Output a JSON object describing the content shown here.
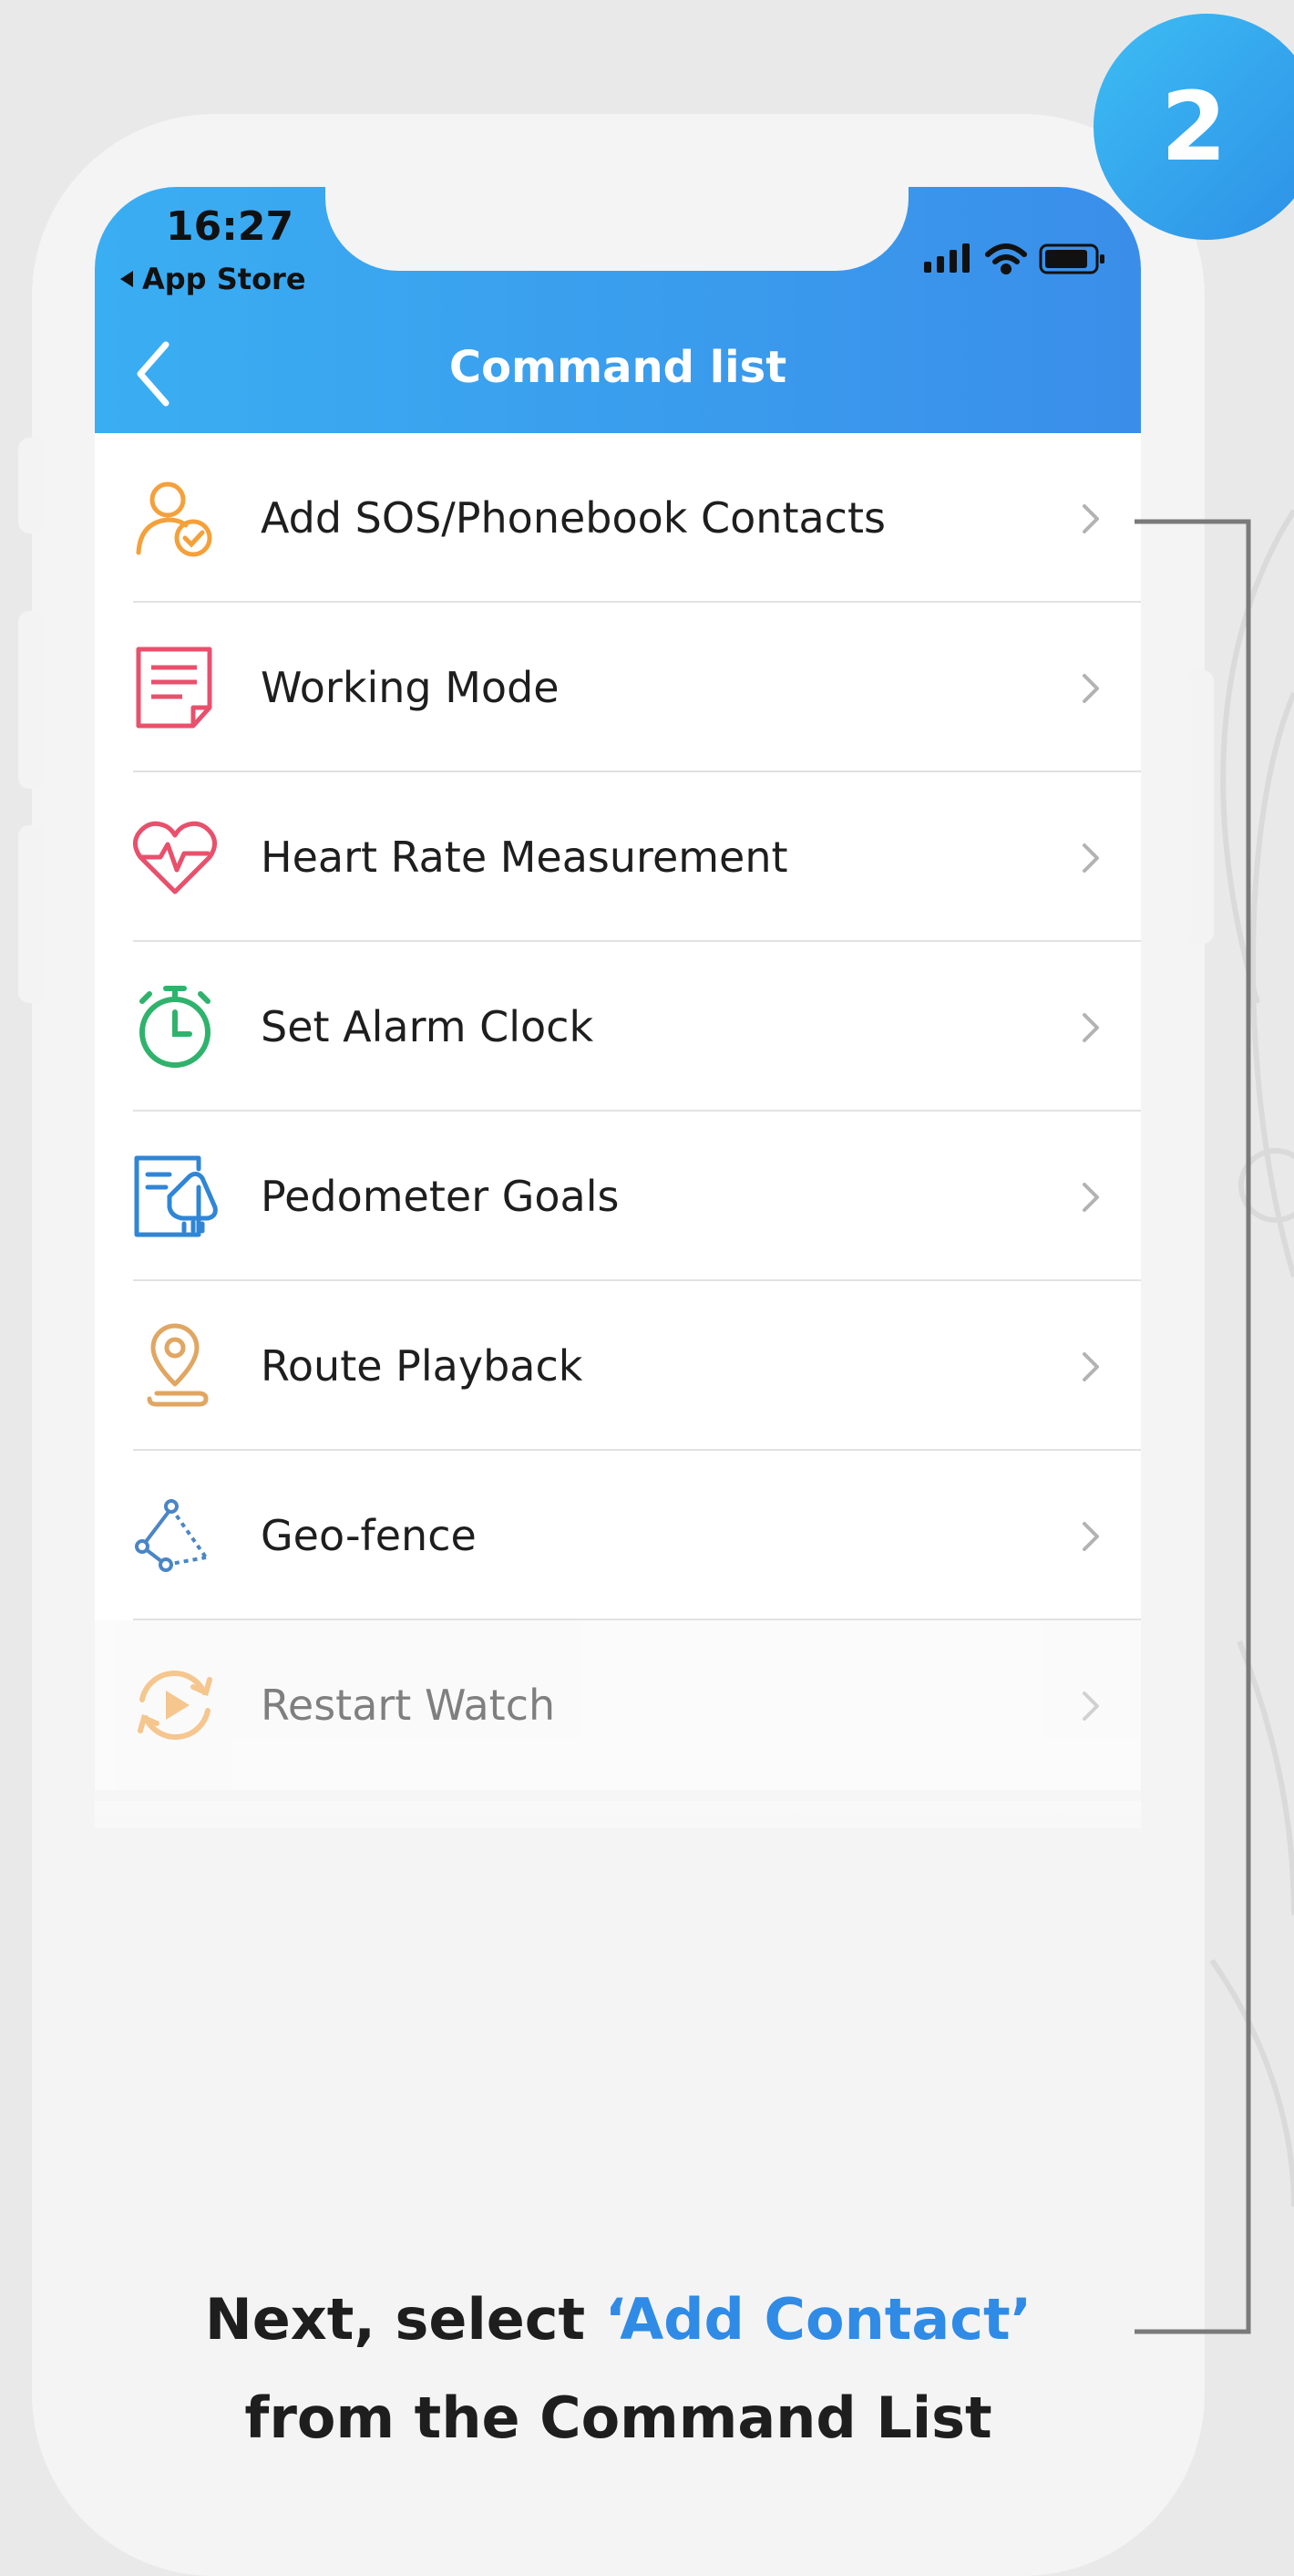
{
  "step_badge": "2",
  "status_bar": {
    "time": "16:27",
    "back_app": "App Store"
  },
  "nav": {
    "title": "Command list"
  },
  "commands": [
    {
      "label": "Add SOS/Phonebook Contacts",
      "icon": "person-check-icon",
      "color": "#f5a03a"
    },
    {
      "label": "Working Mode",
      "icon": "document-icon",
      "color": "#e9506c"
    },
    {
      "label": "Heart Rate Measurement",
      "icon": "heart-rate-icon",
      "color": "#e9506c"
    },
    {
      "label": "Set Alarm Clock",
      "icon": "alarm-clock-icon",
      "color": "#2fb36c"
    },
    {
      "label": "Pedometer Goals",
      "icon": "pedometer-icon",
      "color": "#2f86d6"
    },
    {
      "label": "Route Playback",
      "icon": "location-pin-icon",
      "color": "#e0a662"
    },
    {
      "label": "Geo-fence",
      "icon": "geofence-icon",
      "color": "#4a86c6"
    },
    {
      "label": "Restart Watch",
      "icon": "restart-icon",
      "color": "#f5a03a"
    }
  ],
  "caption": {
    "prefix": "Next, select ",
    "highlight": "‘Add Contact’",
    "line2": "from the Command List"
  },
  "colors": {
    "accent": "#2f8be6",
    "header": "#3a9ef0"
  }
}
